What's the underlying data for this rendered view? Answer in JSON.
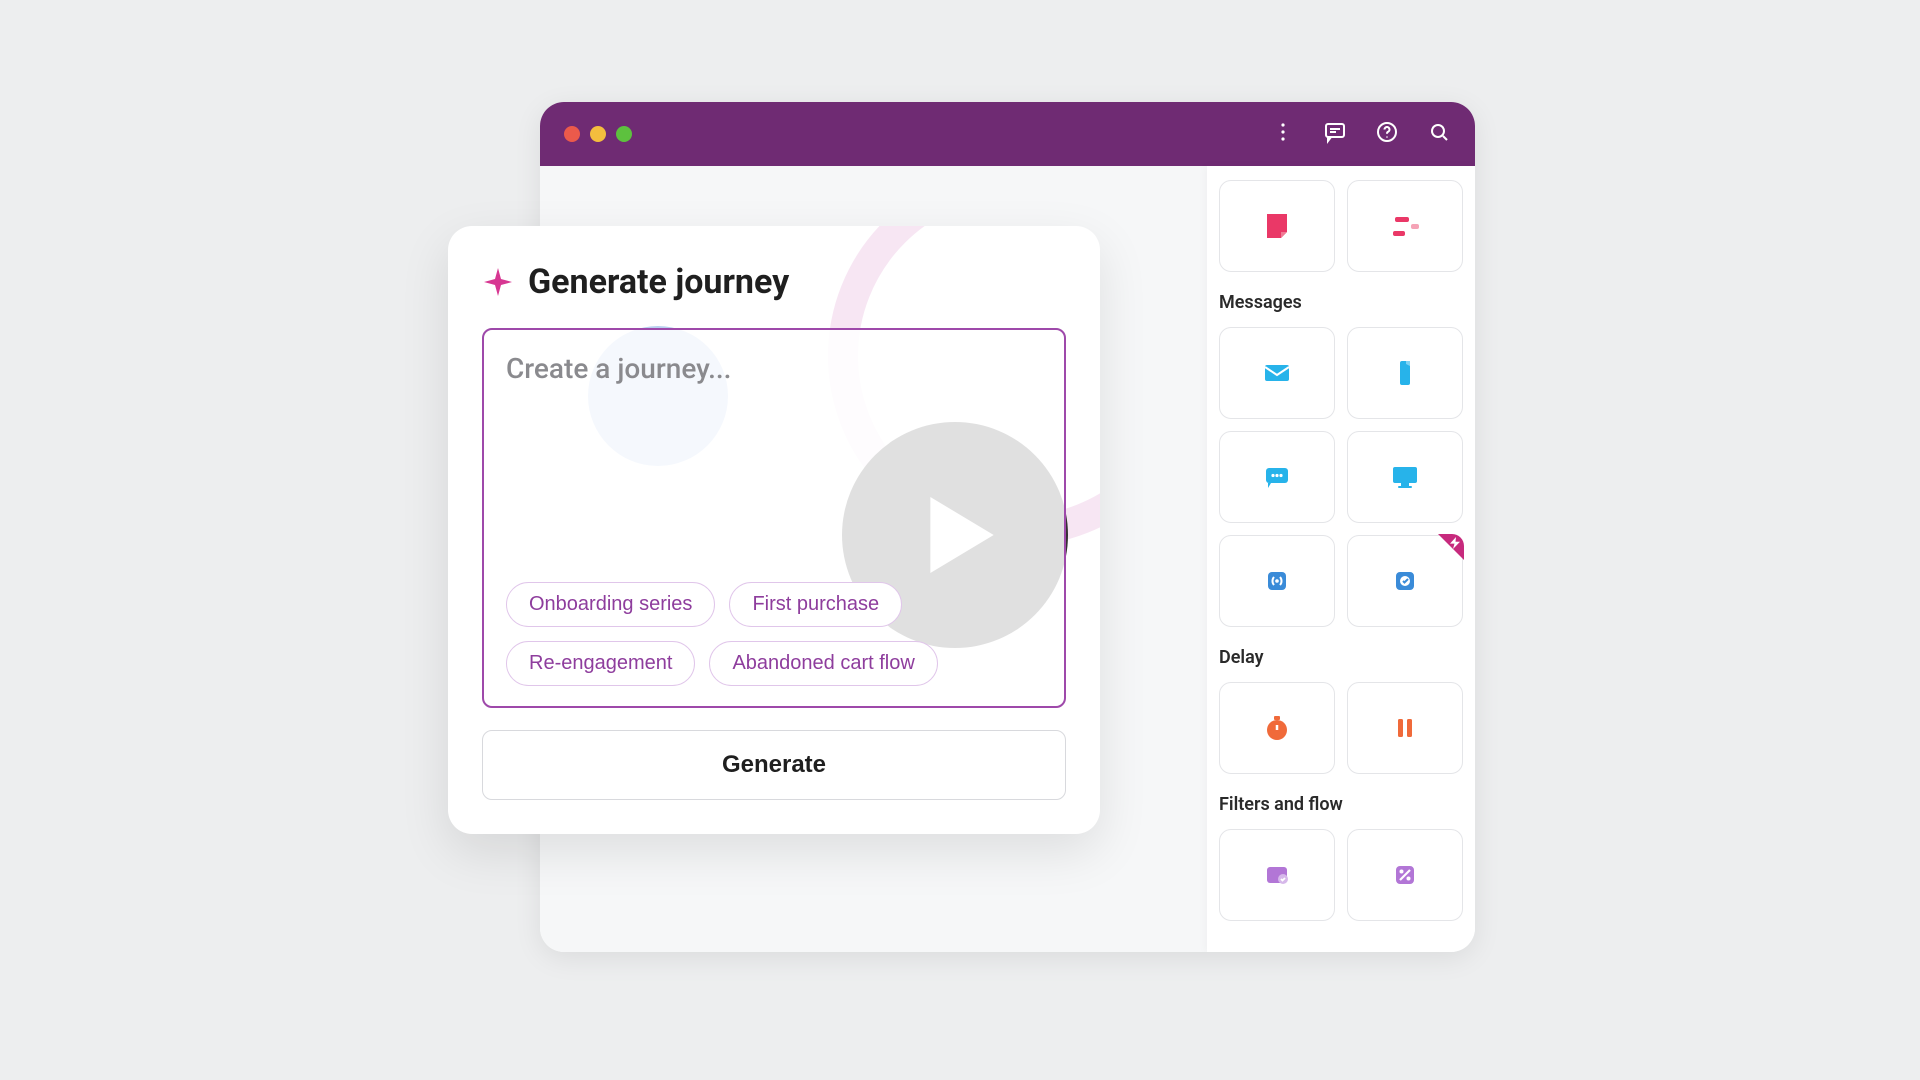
{
  "gen": {
    "title": "Generate journey",
    "placeholder": "Create a journey...",
    "suggestions": [
      "Onboarding series",
      "First purchase",
      "Re-engagement",
      "Abandoned cart flow"
    ],
    "button": "Generate"
  },
  "palette": {
    "sections": {
      "messages_label": "Messages",
      "delay_label": "Delay",
      "filters_label": "Filters and flow"
    }
  },
  "icons": {
    "note": "note-icon",
    "bars": "bars-icon",
    "email": "email-icon",
    "mobile": "mobile-icon",
    "sms": "sms-icon",
    "desktop": "desktop-icon",
    "widget1": "broadcast-icon",
    "widget2": "check-app-icon",
    "timer": "timer-icon",
    "pause": "pause-icon",
    "filter1": "filter-icon",
    "filter2": "percent-icon"
  },
  "colors": {
    "brand": "#6f2b73",
    "accent_pink": "#ea3867",
    "accent_cyan": "#27b3ea",
    "accent_blue": "#3a8bd8",
    "accent_orange": "#f06a3a",
    "accent_violet": "#b276d6"
  }
}
